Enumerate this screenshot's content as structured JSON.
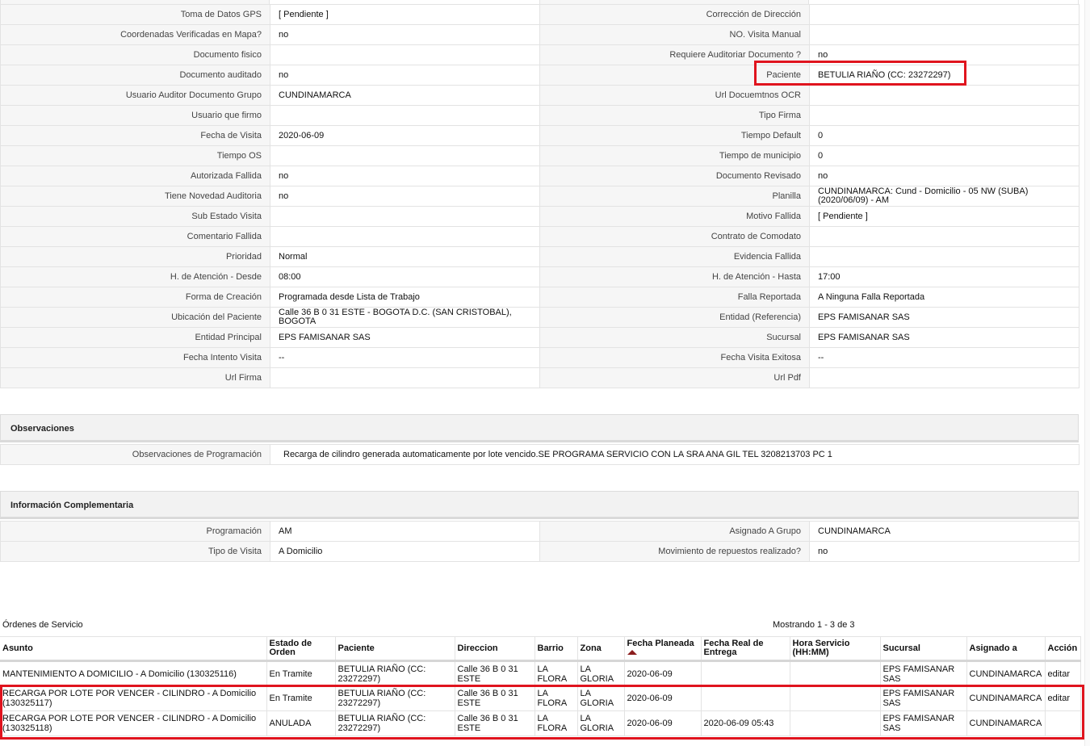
{
  "details": [
    {
      "l1": "Toma de Datos GPS",
      "v1": "[ Pendiente ]",
      "l2": "Corrección de Dirección",
      "v2": ""
    },
    {
      "l1": "Coordenadas Verificadas en Mapa?",
      "v1": "no",
      "l2": "NO. Visita Manual",
      "v2": ""
    },
    {
      "l1": "Documento fisico",
      "v1": "",
      "l2": "Requiere Auditoriar Documento ?",
      "v2": "no"
    },
    {
      "l1": "Documento auditado",
      "v1": "no",
      "l2": "Paciente",
      "v2": "BETULIA RIAÑO (CC: 23272297)"
    },
    {
      "l1": "Usuario Auditor Documento Grupo",
      "v1": "CUNDINAMARCA",
      "l2": "Url Docuemtnos OCR",
      "v2": ""
    },
    {
      "l1": "Usuario que firmo",
      "v1": "",
      "l2": "Tipo Firma",
      "v2": ""
    },
    {
      "l1": "Fecha de Visita",
      "v1": "2020-06-09",
      "l2": "Tiempo Default",
      "v2": "0"
    },
    {
      "l1": "Tiempo OS",
      "v1": "",
      "l2": "Tiempo de municipio",
      "v2": "0"
    },
    {
      "l1": "Autorizada Fallida",
      "v1": "no",
      "l2": "Documento Revisado",
      "v2": "no"
    },
    {
      "l1": "Tiene Novedad Auditoria",
      "v1": "no",
      "l2": "Planilla",
      "v2": "CUNDINAMARCA: Cund - Domicilio - 05 NW (SUBA) (2020/06/09) - AM"
    },
    {
      "l1": "Sub Estado Visita",
      "v1": "",
      "l2": "Motivo Fallida",
      "v2": "[ Pendiente ]"
    },
    {
      "l1": "Comentario Fallida",
      "v1": "",
      "l2": "Contrato de Comodato",
      "v2": ""
    },
    {
      "l1": "Prioridad",
      "v1": "Normal",
      "l2": "Evidencia Fallida",
      "v2": ""
    },
    {
      "l1": "H. de Atención - Desde",
      "v1": "08:00",
      "l2": "H. de Atención - Hasta",
      "v2": "17:00"
    },
    {
      "l1": "Forma de Creación",
      "v1": "Programada desde Lista de Trabajo",
      "l2": "Falla Reportada",
      "v2": "A Ninguna Falla Reportada"
    },
    {
      "l1": "Ubicación del Paciente",
      "v1": "Calle 36 B 0 31 ESTE - BOGOTA D.C. (SAN CRISTOBAL), BOGOTA",
      "l2": "Entidad (Referencia)",
      "v2": "EPS FAMISANAR SAS"
    },
    {
      "l1": "Entidad Principal",
      "v1": "EPS FAMISANAR SAS",
      "l2": "Sucursal",
      "v2": "EPS FAMISANAR SAS"
    },
    {
      "l1": "Fecha Intento Visita",
      "v1": "--",
      "l2": "Fecha Visita Exitosa",
      "v2": "--"
    },
    {
      "l1": "Url Firma",
      "v1": "",
      "l2": "Url Pdf",
      "v2": ""
    }
  ],
  "observaciones": {
    "title": "Observaciones",
    "label": "Observaciones de Programación",
    "value": "Recarga de cilindro generada automaticamente por lote vencido.SE PROGRAMA SERVICIO CON LA SRA ANA GIL TEL 3208213703 PC 1"
  },
  "complementaria": {
    "title": "Información Complementaria",
    "rows": [
      {
        "l1": "Programación",
        "v1": "AM",
        "l2": "Asignado A Grupo",
        "v2": "CUNDINAMARCA"
      },
      {
        "l1": "Tipo de Visita",
        "v1": "A Domicilio",
        "l2": "Movimiento de repuestos realizado?",
        "v2": "no"
      }
    ]
  },
  "orders": {
    "title": "Órdenes de Servicio",
    "count_text": "Mostrando 1 - 3 de 3",
    "columns": [
      "Asunto",
      "Estado de Orden",
      "Paciente",
      "Direccion",
      "Barrio",
      "Zona",
      "Fecha Planeada",
      "Fecha Real de Entrega",
      "Hora Servicio (HH:MM)",
      "Sucursal",
      "Asignado a",
      "Acción"
    ],
    "rows": [
      {
        "asunto": "MANTENIMIENTO A DOMICILIO - A Domicilio (130325116)",
        "estado": "En Tramite",
        "paciente": "BETULIA RIAÑO (CC: 23272297)",
        "direccion": "Calle 36 B 0 31 ESTE",
        "barrio": "LA FLORA",
        "zona": "LA GLORIA",
        "fecha_planeada": "2020-06-09",
        "fecha_real": "",
        "hora": "",
        "sucursal": "EPS FAMISANAR SAS",
        "asignado": "CUNDINAMARCA",
        "accion": "editar"
      },
      {
        "asunto": "RECARGA POR LOTE POR VENCER - CILINDRO - A Domicilio (130325117)",
        "estado": "En Tramite",
        "paciente": "BETULIA RIAÑO (CC: 23272297)",
        "direccion": "Calle 36 B 0 31 ESTE",
        "barrio": "LA FLORA",
        "zona": "LA GLORIA",
        "fecha_planeada": "2020-06-09",
        "fecha_real": "",
        "hora": "",
        "sucursal": "EPS FAMISANAR SAS",
        "asignado": "CUNDINAMARCA",
        "accion": "editar"
      },
      {
        "asunto": "RECARGA POR LOTE POR VENCER - CILINDRO - A Domicilio (130325118)",
        "estado": "ANULADA",
        "paciente": "BETULIA RIAÑO (CC: 23272297)",
        "direccion": "Calle 36 B 0 31 ESTE",
        "barrio": "LA FLORA",
        "zona": "LA GLORIA",
        "fecha_planeada": "2020-06-09",
        "fecha_real": "2020-06-09 05:43",
        "hora": "",
        "sucursal": "EPS FAMISANAR SAS",
        "asignado": "CUNDINAMARCA",
        "accion": ""
      }
    ]
  },
  "colors": {
    "highlight": "#e0141e",
    "sort_arrow": "#8b1d1d"
  },
  "icons": {
    "sort": "sort-ascending-icon"
  }
}
